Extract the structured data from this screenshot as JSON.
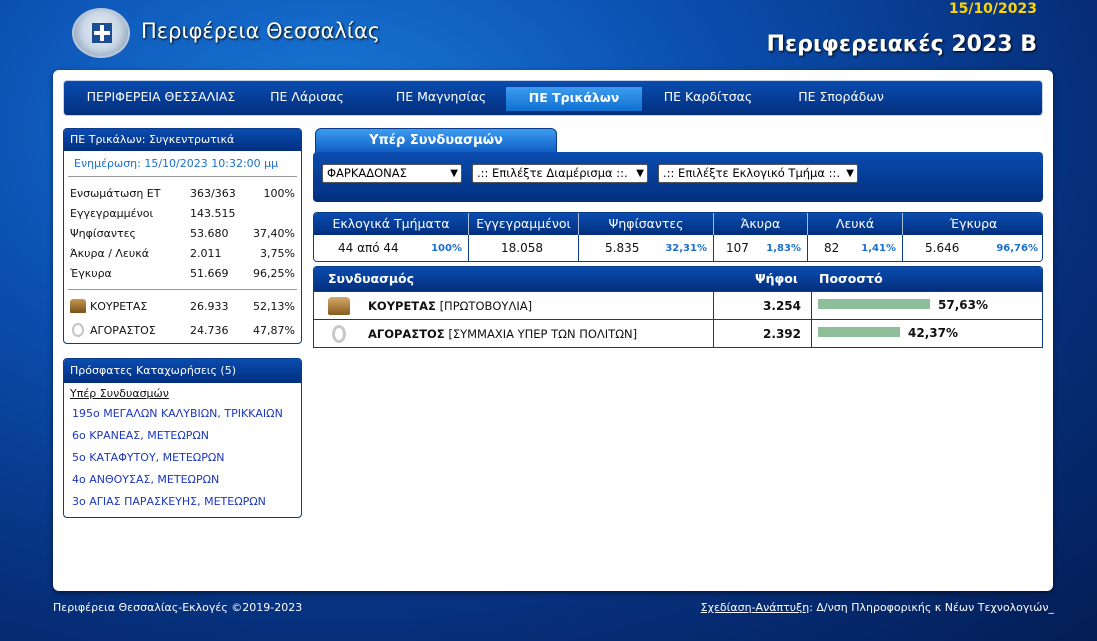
{
  "header": {
    "region_title": "Περιφέρεια Θεσσαλίας",
    "date": "15/10/2023",
    "election_title": "Περιφερειακές 2023 Β"
  },
  "nav": {
    "items": [
      {
        "label": "ΠΕΡΙΦΕΡΕΙΑ ΘΕΣΣΑΛΙΑΣ",
        "active": false
      },
      {
        "label": "ΠΕ Λάρισας",
        "active": false
      },
      {
        "label": "ΠΕ Μαγνησίας",
        "active": false
      },
      {
        "label": "ΠΕ Τρικάλων",
        "active": true
      },
      {
        "label": "ΠΕ Καρδίτσας",
        "active": false
      },
      {
        "label": "ΠΕ Σποράδων",
        "active": false
      }
    ]
  },
  "summary": {
    "title": "ΠΕ Τρικάλων: Συγκεντρωτικά",
    "update": "Ενημέρωση: 15/10/2023 10:32:00 μμ",
    "rows": [
      {
        "label": "Ενσωμάτωση ΕΤ",
        "value": "363/363",
        "pct": "100%"
      },
      {
        "label": "Εγγεγραμμένοι",
        "value": "143.515",
        "pct": ""
      },
      {
        "label": "Ψηφίσαντες",
        "value": "53.680",
        "pct": "37,40%"
      },
      {
        "label": "Άκυρα / Λευκά",
        "value": "2.011",
        "pct": "3,75%"
      },
      {
        "label": "Έγκυρα",
        "value": "51.669",
        "pct": "96,25%"
      }
    ],
    "candidates": [
      {
        "name": "ΚΟΥΡΕΤΑΣ",
        "value": "26.933",
        "pct": "52,13%",
        "icon": "kouretas-logo-icon"
      },
      {
        "name": "ΑΓΟΡΑΣΤΟΣ",
        "value": "24.736",
        "pct": "47,87%",
        "icon": "agorastos-logo-icon"
      }
    ]
  },
  "recent": {
    "title": "Πρόσφατες Καταχωρήσεις (5)",
    "subtitle": "Υπέρ Συνδυασμών",
    "items": [
      "195ο ΜΕΓΑΛΩΝ ΚΑΛΥΒΙΩΝ, ΤΡΙΚΚΑΙΩΝ",
      "6ο ΚΡΑΝΕΑΣ, ΜΕΤΕΩΡΩΝ",
      "5ο ΚΑΤΑΦΥΤΟΥ, ΜΕΤΕΩΡΩΝ",
      "4ο ΑΝΘΟΥΣΑΣ, ΜΕΤΕΩΡΩΝ",
      "3ο ΑΓΙΑΣ ΠΑΡΑΣΚΕΥΗΣ, ΜΕΤΕΩΡΩΝ"
    ]
  },
  "tab": {
    "label": "Υπέρ Συνδυασμών"
  },
  "filters": {
    "municipality": "ΦΑΡΚΑΔΟΝΑΣ",
    "district": ".:: Επιλέξτε Διαμέρισμα ::.",
    "station": ".:: Επιλέξτε Εκλογικό Τμήμα ::."
  },
  "stats": {
    "headers": [
      "Εκλογικά Τμήματα",
      "Εγγεγραμμένοι",
      "Ψηφίσαντες",
      "Άκυρα",
      "Λευκά",
      "Έγκυρα"
    ],
    "values": [
      {
        "main": "44 από 44",
        "pct": "100%"
      },
      {
        "main": "18.058",
        "pct": ""
      },
      {
        "main": "5.835",
        "pct": "32,31%"
      },
      {
        "main": "107",
        "pct": "1,83%"
      },
      {
        "main": "82",
        "pct": "1,41%"
      },
      {
        "main": "5.646",
        "pct": "96,76%"
      }
    ]
  },
  "results": {
    "headers": {
      "party": "Συνδυασμός",
      "votes": "Ψήφοι",
      "pct": "Ποσοστό"
    },
    "rows": [
      {
        "name": "ΚΟΥΡΕΤΑΣ",
        "party": "[ΠΡΩΤΟΒΟΥΛΙΑ]",
        "votes": "3.254",
        "pct": "57,63%",
        "share": 57.63
      },
      {
        "name": "ΑΓΟΡΑΣΤΟΣ",
        "party": "[ΣΥΜΜΑΧΙΑ ΥΠΕΡ ΤΩΝ ΠΟΛΙΤΩΝ]",
        "votes": "2.392",
        "pct": "42,37%",
        "share": 42.37
      }
    ]
  },
  "footer": {
    "left": "Περιφέρεια Θεσσαλίας-Εκλογές ©2019-2023",
    "design_link": "Σχεδίαση-Ανάπτυξη",
    "design_text": ": Δ/νση Πληροφορικής κ Νέων Τεχνολογιών_"
  }
}
